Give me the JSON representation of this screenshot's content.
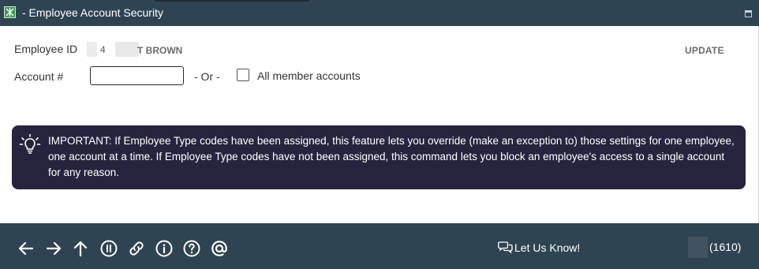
{
  "window": {
    "title": "- Employee Account Security",
    "icon": "app-icon",
    "button": "restore-icon"
  },
  "form": {
    "employee_id_label": "Employee ID",
    "employee_id_value": "4",
    "employee_name": "T BROWN",
    "update_label": "UPDATE",
    "account_label": "Account #",
    "account_value": "",
    "or_label": "- Or -",
    "all_accounts_label": "All member accounts",
    "all_accounts_checked": false
  },
  "notice": {
    "icon": "lightbulb-icon",
    "text": "IMPORTANT: If Employee Type codes have been assigned, this feature lets you override (make an exception to) those settings for one employee, one account at a time. If Employee Type codes have not been assigned, this command lets you block an employee's access to a single account for any reason."
  },
  "footer": {
    "buttons": [
      "back-arrow-icon",
      "forward-arrow-icon",
      "up-arrow-icon",
      "pause-icon",
      "link-icon",
      "info-icon",
      "help-icon",
      "at-sign-icon"
    ],
    "feedback_label": "Let Us Know!",
    "code": "(1610)"
  },
  "colors": {
    "header_bg": "#2f4452",
    "footer_bg": "#2f4452",
    "notice_bg": "#26243f",
    "text_dark": "#333333",
    "icon_green": "#3e9a52"
  }
}
